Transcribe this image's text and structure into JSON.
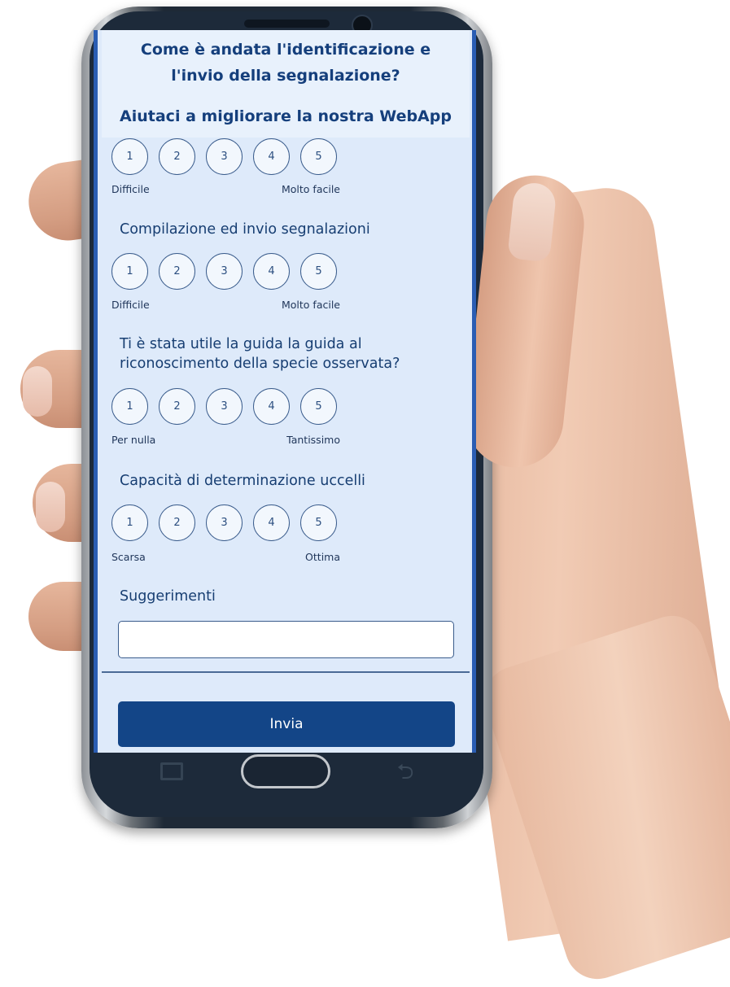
{
  "header": {
    "title_line1": "Come è andata l'identificazione e",
    "title_line2": "l'invio della segnalazione?",
    "subtitle": "Aiutaci a migliorare la nostra WebApp"
  },
  "questions": [
    {
      "title_lines": [],
      "labels": [
        "1",
        "2",
        "3",
        "4",
        "5"
      ],
      "scale_low": "Difficile",
      "scale_high": "Molto facile"
    },
    {
      "title_lines": [
        "Compilazione ed invio segnalazioni"
      ],
      "labels": [
        "1",
        "2",
        "3",
        "4",
        "5"
      ],
      "scale_low": "Difficile",
      "scale_high": "Molto facile"
    },
    {
      "title_lines": [
        "Ti è stata utile la guida la guida al",
        "riconoscimento della specie osservata?"
      ],
      "labels": [
        "1",
        "2",
        "3",
        "4",
        "5"
      ],
      "scale_low": "Per nulla",
      "scale_high": "Tantissimo"
    },
    {
      "title_lines": [
        "Capacità di determinazione uccelli"
      ],
      "labels": [
        "1",
        "2",
        "3",
        "4",
        "5"
      ],
      "scale_low": "Scarsa",
      "scale_high": "Ottima"
    }
  ],
  "suggestions": {
    "label": "Suggerimenti",
    "value": "",
    "placeholder": ""
  },
  "submit_label": "Invia",
  "colors": {
    "accent": "#134587",
    "screen_background": "#deeafa",
    "title_text": "#153f7c",
    "screen_border": "#2a5db3"
  }
}
